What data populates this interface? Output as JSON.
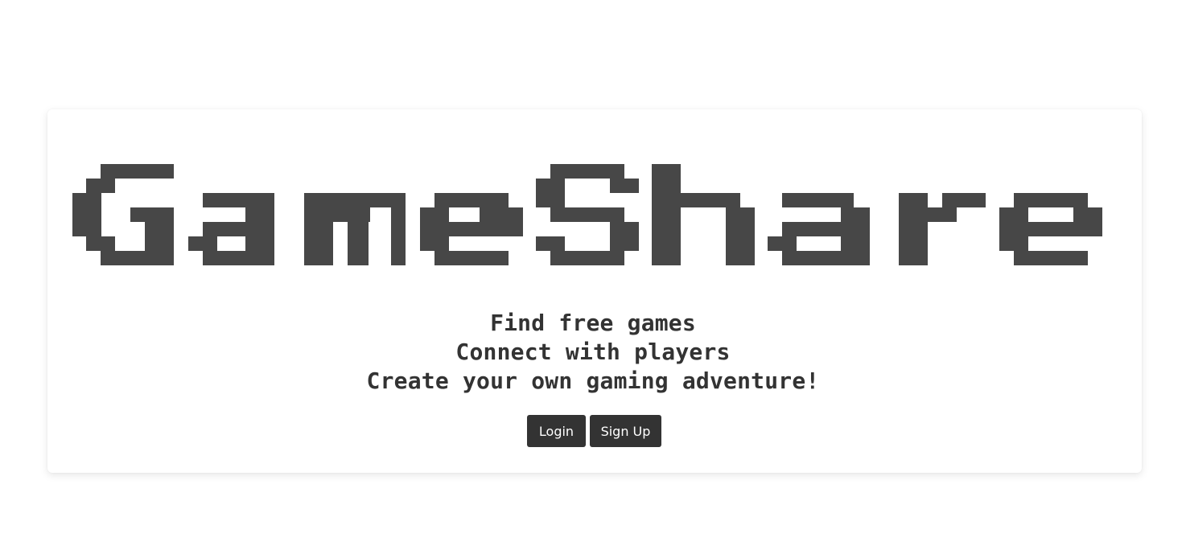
{
  "logo": {
    "text": "GameShare",
    "color": "#474747"
  },
  "tagline": {
    "lines": [
      "Find free games",
      "Connect with players",
      "Create your own gaming adventure!"
    ]
  },
  "actions": {
    "login_label": "Login",
    "signup_label": "Sign Up"
  },
  "colors": {
    "button_bg": "#333333",
    "text": "#333333",
    "page_bg": "#ffffff"
  }
}
